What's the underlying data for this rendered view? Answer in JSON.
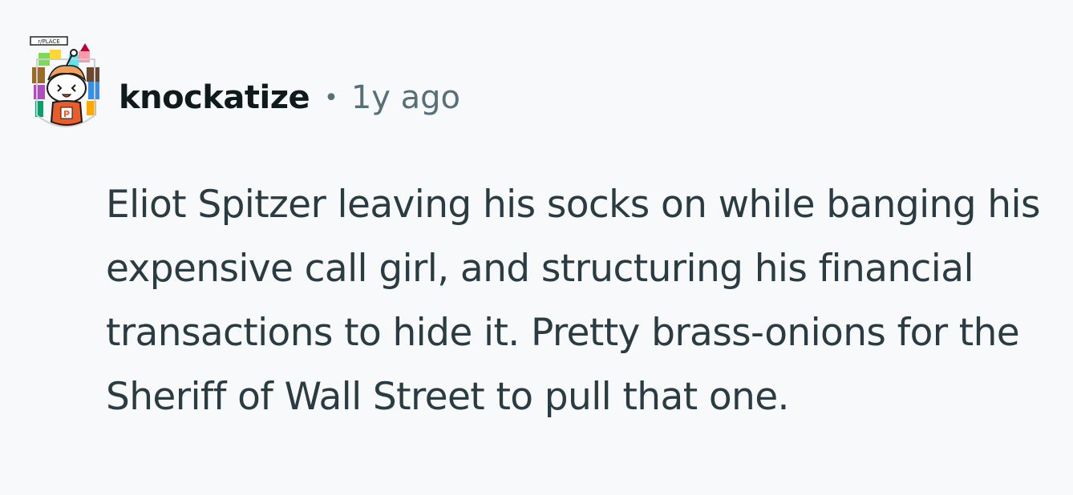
{
  "comment": {
    "author": "knockatize",
    "separator": "•",
    "timestamp": "1y ago",
    "avatar_badge": "r/PLACE",
    "avatar_icon": "snoo-avatar-icon",
    "body": "Eliot Spitzer leaving his socks on while banging his expensive call girl, and structuring his financial transactions to hide it. Pretty brass-onions for the Sheriff of Wall Street to pull that one."
  },
  "colors": {
    "background": "#f7f9fa",
    "username": "#0f1a1c",
    "meta": "#576f76",
    "body": "#2a3c42"
  }
}
